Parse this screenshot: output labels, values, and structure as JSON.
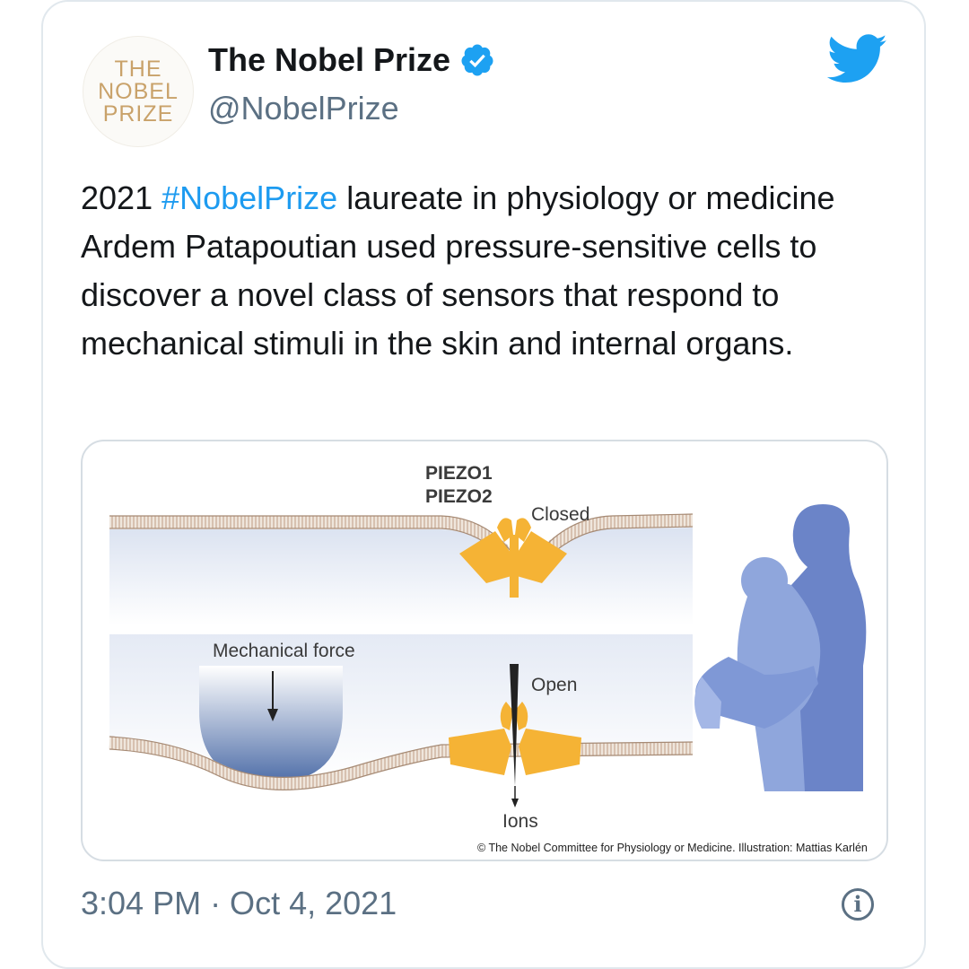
{
  "tweet": {
    "author_name": "The Nobel Prize",
    "handle": "@NobelPrize",
    "avatar_lines": [
      "THE",
      "NOBEL",
      "PRIZE"
    ],
    "text_before": "2021 ",
    "hashtag": "#NobelPrize",
    "text_after": " laureate in physiology or medicine Ardem Patapoutian used pressure-sensitive cells to discover a novel class of sensors that respond to mechanical stimuli in the skin and internal organs.",
    "timestamp": "3:04 PM · Oct 4, 2021",
    "info_icon_glyph": "i"
  },
  "illustration": {
    "label_piezo1": "PIEZO1",
    "label_piezo2": "PIEZO2",
    "label_closed": "Closed",
    "label_open": "Open",
    "label_force": "Mechanical force",
    "label_ions": "Ions",
    "credit": "© The Nobel Committee for Physiology or Medicine. Illustration: Mattias Karlén"
  },
  "icons": {
    "verified": "verified-badge-icon",
    "bird": "twitter-bird-icon",
    "info": "info-icon"
  },
  "colors": {
    "link": "#1d9bf0",
    "secondary_text": "#5b7083",
    "channel": "#f5b335",
    "figure_blue": "#6b84c8",
    "twitter_blue": "#1da1f2"
  }
}
